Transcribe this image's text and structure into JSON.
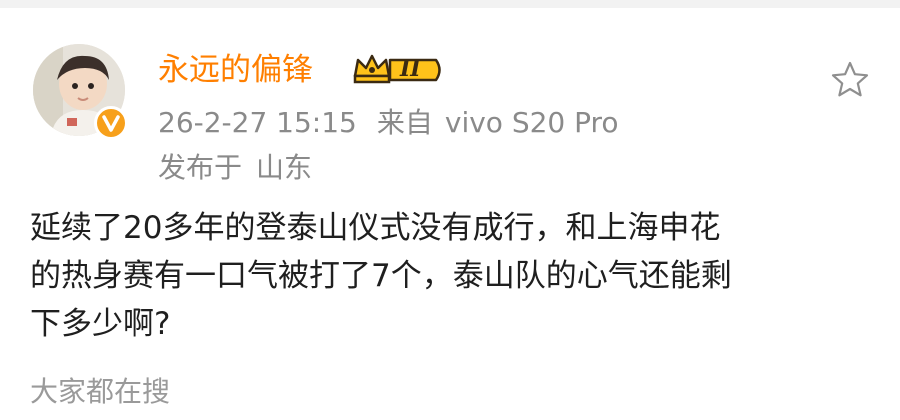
{
  "user": {
    "name": "永远的偏锋",
    "member_level": "II"
  },
  "post": {
    "time": "26-2-27 15:15",
    "source_label": "来自",
    "source_device": "vivo S20 Pro",
    "location_label": "发布于",
    "location": "山东",
    "text_lines": [
      "延续了20多年的登泰山仪式没有成行，和上海申花",
      "的热身赛有一口气被打了7个，泰山队的心气还能剩",
      "下多少啊?"
    ]
  },
  "footer": {
    "hot_search_label": "大家都在搜"
  },
  "colors": {
    "name": "#ff7f00",
    "meta": "#8a8a8a",
    "body": "#1f1f1f",
    "badge_gold": "#f7a01b"
  },
  "icons": {
    "verified": "verified-v-icon",
    "member": "crown-icon",
    "favorite": "star-outline-icon"
  }
}
